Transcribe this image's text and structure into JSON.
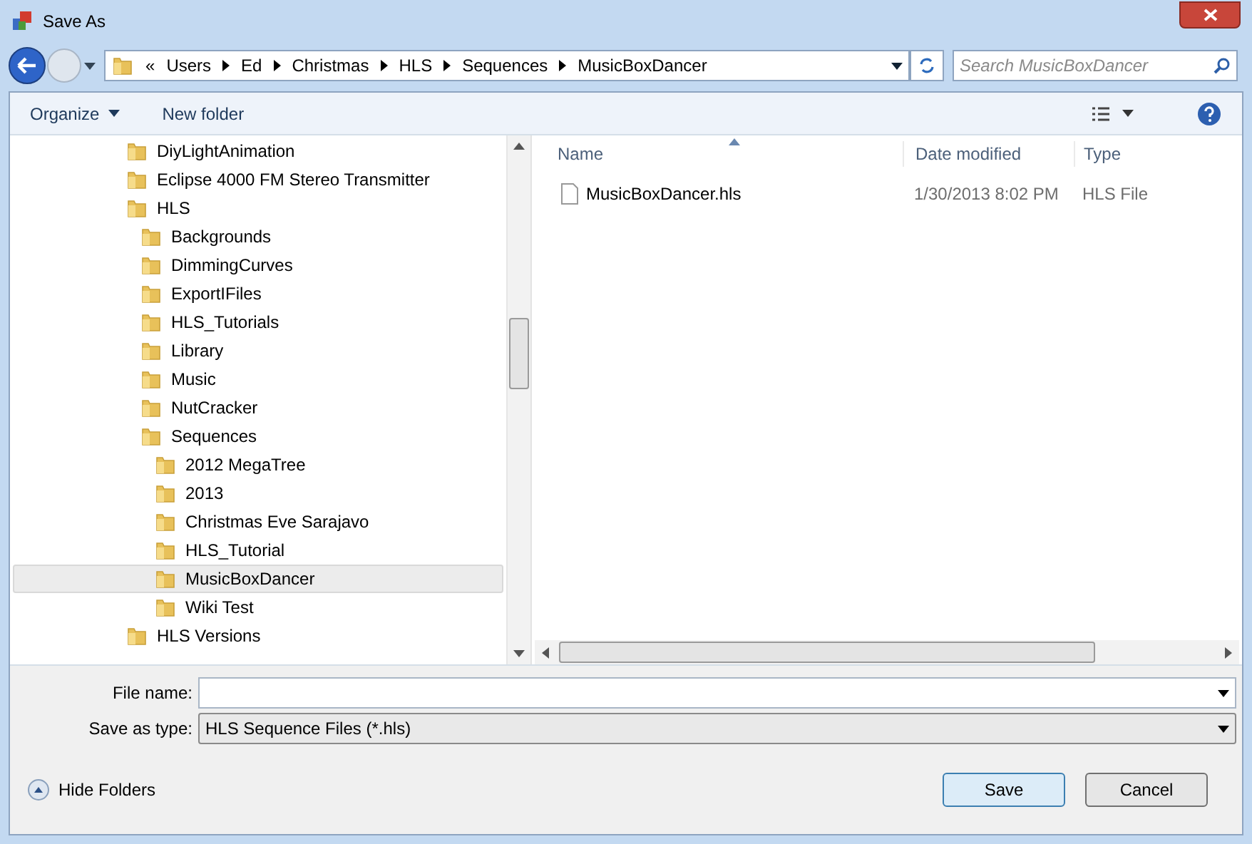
{
  "window": {
    "title": "Save As"
  },
  "address": {
    "overflow": "«",
    "crumbs": [
      "Users",
      "Ed",
      "Christmas",
      "HLS",
      "Sequences",
      "MusicBoxDancer"
    ]
  },
  "search": {
    "placeholder": "Search MusicBoxDancer"
  },
  "toolbar": {
    "organize": "Organize",
    "new_folder": "New folder"
  },
  "tree": [
    {
      "label": "DiyLightAnimation",
      "selected": false
    },
    {
      "label": "Eclipse 4000 FM Stereo Transmitter",
      "selected": false
    },
    {
      "label": "HLS",
      "selected": false,
      "children": [
        {
          "label": "Backgrounds",
          "selected": false
        },
        {
          "label": "DimmingCurves",
          "selected": false
        },
        {
          "label": "ExportIFiles",
          "selected": false
        },
        {
          "label": "HLS_Tutorials",
          "selected": false
        },
        {
          "label": "Library",
          "selected": false
        },
        {
          "label": "Music",
          "selected": false
        },
        {
          "label": "NutCracker",
          "selected": false
        },
        {
          "label": "Sequences",
          "selected": false,
          "children": [
            {
              "label": "2012 MegaTree",
              "selected": false
            },
            {
              "label": "2013",
              "selected": false
            },
            {
              "label": "Christmas Eve Sarajavo",
              "selected": false
            },
            {
              "label": "HLS_Tutorial",
              "selected": false
            },
            {
              "label": "MusicBoxDancer",
              "selected": true
            },
            {
              "label": "Wiki Test",
              "selected": false
            }
          ]
        }
      ]
    },
    {
      "label": "HLS Versions",
      "selected": false
    }
  ],
  "files": {
    "columns": [
      "Name",
      "Date modified",
      "Type"
    ],
    "rows": [
      {
        "name": "MusicBoxDancer.hls",
        "date": "1/30/2013 8:02 PM",
        "type": "HLS File"
      }
    ]
  },
  "form": {
    "file_name_label": "File name:",
    "type_label": "Save as type:",
    "type_value": "HLS Sequence Files (*.hls)"
  },
  "footer": {
    "hide_folders": "Hide Folders",
    "buttons": [
      "Save",
      "Cancel"
    ]
  }
}
